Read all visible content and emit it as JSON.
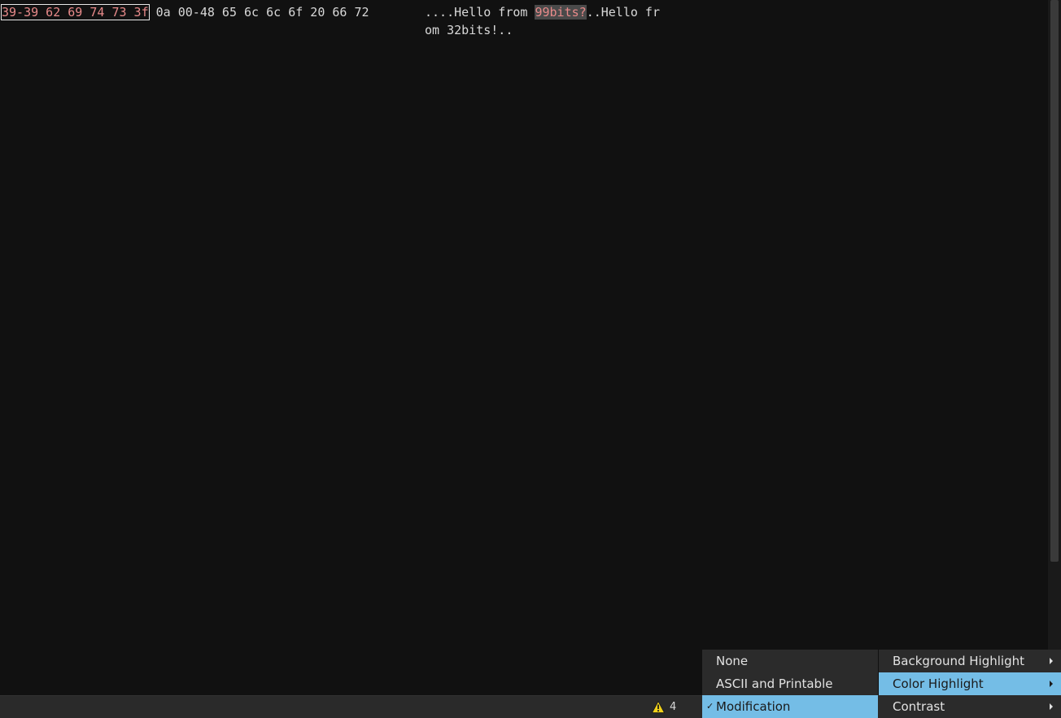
{
  "editor": {
    "hex_modified": "39-39 62 69 74 73 3f",
    "hex_rest": " 0a 00-48 65 6c 6c 6f 20 66 72",
    "ascii_line1_pre": "....Hello from ",
    "ascii_line1_mod": "99bits?",
    "ascii_line1_post": "..Hello fr",
    "ascii_line2": "om 32bits!.."
  },
  "status": {
    "warning_count": "4"
  },
  "menus": {
    "highlight_modes": [
      {
        "label": "None",
        "checked": false
      },
      {
        "label": "ASCII and Printable",
        "checked": false
      },
      {
        "label": "Modification",
        "checked": true,
        "check_glyph": "✓"
      }
    ],
    "highlight_types": [
      {
        "label": "Background Highlight"
      },
      {
        "label": "Color Highlight"
      },
      {
        "label": "Contrast"
      }
    ]
  },
  "colors": {
    "background": "#111111",
    "modified_text": "#e88a8a",
    "selection": "#74bde6",
    "warning": "#f2d21c"
  }
}
